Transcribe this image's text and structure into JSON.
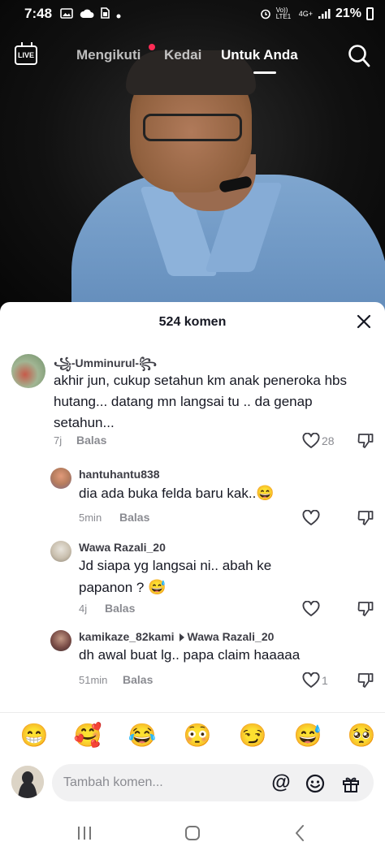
{
  "status_bar": {
    "time": "7:48",
    "left_icons": [
      "image-icon",
      "cloud-icon",
      "sim-icon",
      "dot-icon"
    ],
    "right_icons": [
      "alarm-icon",
      "volte-icon",
      "4g-lte-icon",
      "signal-icon"
    ],
    "volte_label": "Vo)) LTE1",
    "network_label": "4G+",
    "battery": "21%"
  },
  "top_nav": {
    "live_label": "LIVE",
    "tabs": [
      {
        "label": "Mengikuti",
        "active": false,
        "has_dot": true
      },
      {
        "label": "Kedai",
        "active": false
      },
      {
        "label": "Untuk Anda",
        "active": true
      }
    ],
    "accent_dot_color": "#fe2c55"
  },
  "sheet": {
    "title": "524 komen"
  },
  "comments": [
    {
      "user": "꧁-Umminurul-꧂",
      "text": "akhir jun, cukup setahun km anak peneroka hbs hutang... datang mn langsai tu .. da genap setahun...",
      "time": "7j",
      "reply": "Balas",
      "likes": "28",
      "level": "top"
    },
    {
      "user": "hantuhantu838",
      "text": "dia ada buka felda baru kak..",
      "emoji": "😄",
      "time": "5min",
      "reply": "Balas",
      "likes": "",
      "level": "reply"
    },
    {
      "user": "Wawa Razali_20",
      "text": "Jd siapa yg langsai ni.. abah ke papanon ?",
      "emoji": "😅",
      "time": "4j",
      "reply": "Balas",
      "likes": "",
      "level": "reply"
    },
    {
      "user": "kamikaze_82kami",
      "reply_to": "Wawa Razali_20",
      "text": "dh awal buat lg.. papa claim haaaaa",
      "time": "51min",
      "reply": "Balas",
      "likes": "1",
      "level": "reply"
    }
  ],
  "emoji_bar": [
    "😁",
    "🥰",
    "😂",
    "😳",
    "😏",
    "😅",
    "🥺"
  ],
  "input": {
    "placeholder": "Tambah komen...",
    "icons": [
      "at-icon",
      "emoji-icon",
      "gift-icon"
    ],
    "at_symbol": "@"
  },
  "android_nav": [
    "recents-icon",
    "home-icon",
    "back-icon"
  ]
}
